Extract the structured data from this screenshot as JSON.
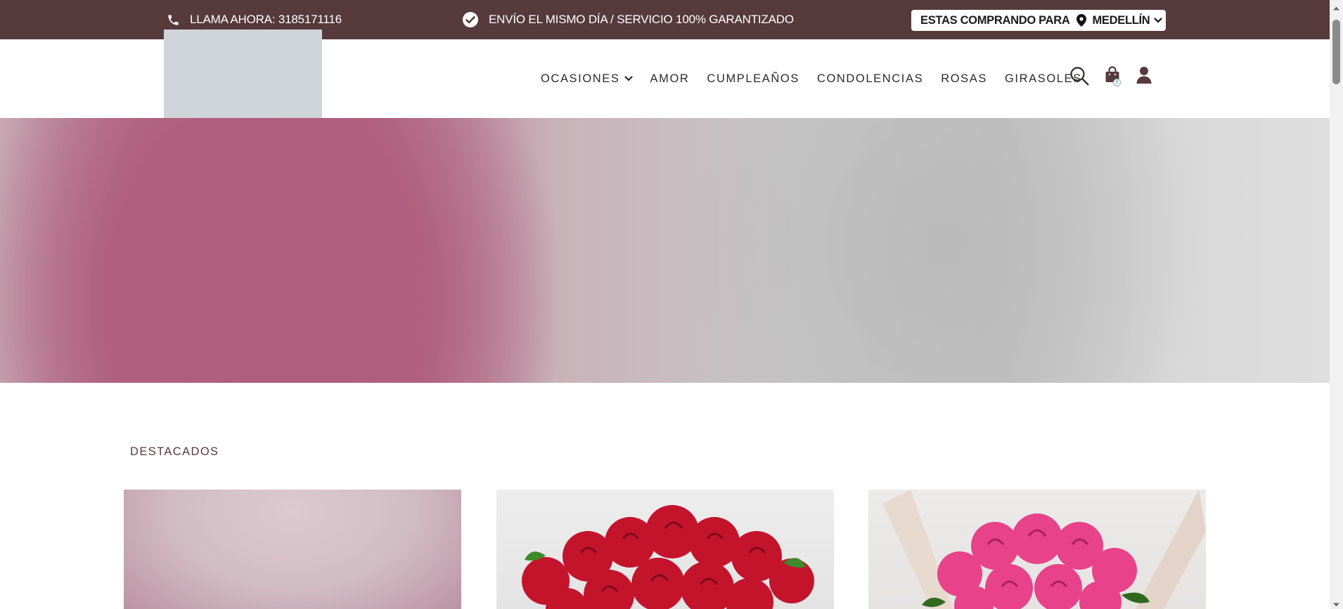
{
  "topbar": {
    "phone_text": "LLAMA AHORA: 3185171116",
    "shipping_text": "ENVÍO EL MISMO DÍA / SERVICIO 100% GARANTIZADO",
    "city_prefix": "ESTAS COMPRANDO PARA",
    "city_value": "MEDELLÍN"
  },
  "nav": {
    "items": [
      "OCASIONES",
      "AMOR",
      "CUMPLEAÑOS",
      "CONDOLENCIAS",
      "ROSAS",
      "GIRASOLES"
    ]
  },
  "header": {
    "cart_count": "0"
  },
  "featured": {
    "title": "DESTACADOS"
  },
  "colors": {
    "brand": "#563a3c",
    "rose_red": "#d11b35",
    "rose_pink": "#e8428a"
  },
  "icons": [
    "phone-icon",
    "check-circle-icon",
    "map-pin-icon",
    "chevron-down-icon",
    "search-icon",
    "shopping-bag-icon",
    "user-icon"
  ]
}
